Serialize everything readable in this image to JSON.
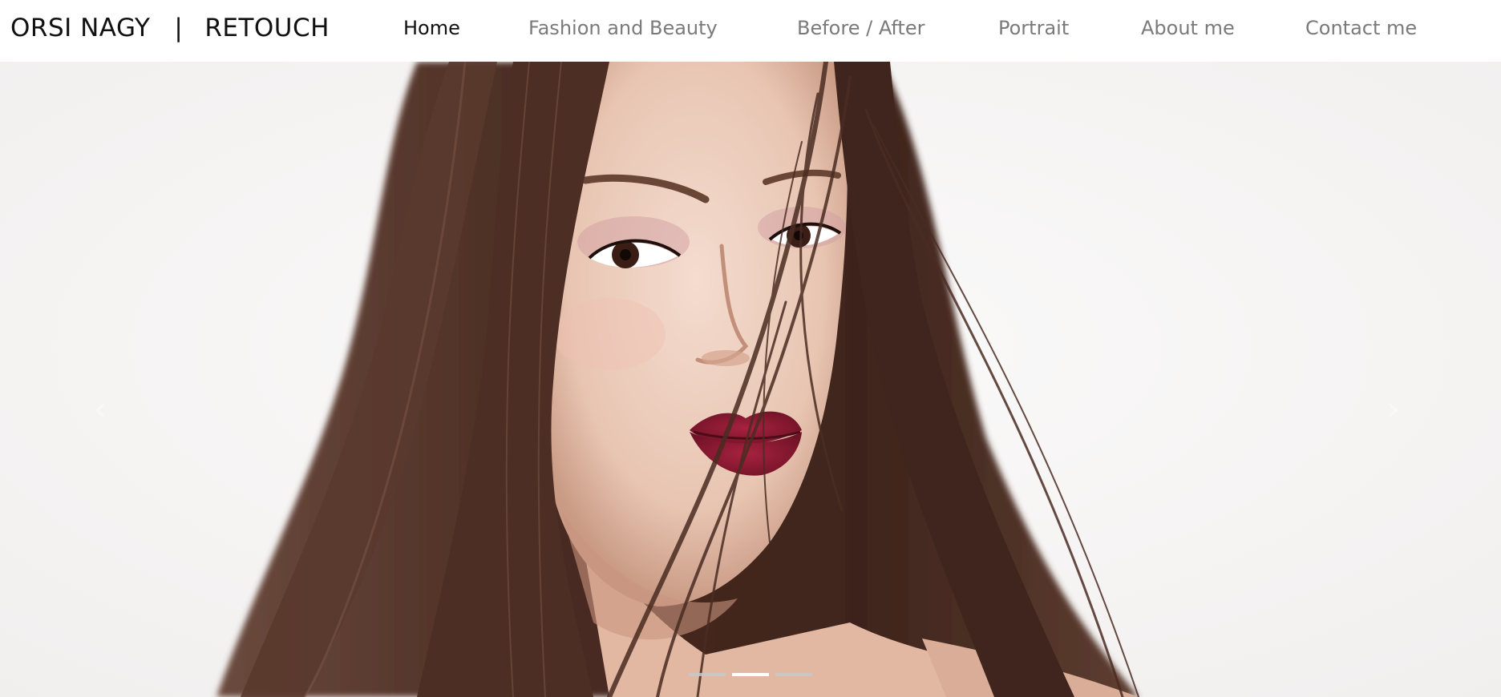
{
  "brand": {
    "name": "ORSI NAGY",
    "separator": "|",
    "tagline": "RETOUCH"
  },
  "nav": {
    "items": [
      {
        "label": "Home",
        "active": true
      },
      {
        "label": "Fashion and Beauty",
        "active": false
      },
      {
        "label": "Before / After",
        "active": false
      },
      {
        "label": "Portrait",
        "active": false
      },
      {
        "label": "About me",
        "active": false
      },
      {
        "label": "Contact me",
        "active": false
      }
    ]
  },
  "carousel": {
    "slide_count": 3,
    "active_slide": 2,
    "prev_icon": "chevron-left-icon",
    "next_icon": "chevron-right-icon",
    "image": "portrait-woman-long-brown-hair-red-lips"
  },
  "colors": {
    "nav_active": "#111111",
    "nav_inactive": "#7a7a7a",
    "hero_background": "#f6f5f4",
    "hair": "#4a2c22",
    "lips": "#8e1a32"
  }
}
